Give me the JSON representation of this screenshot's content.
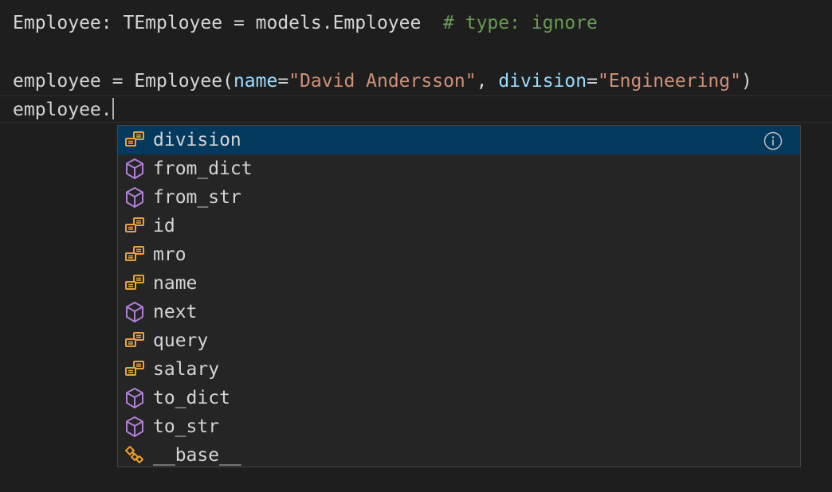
{
  "editor": {
    "line1": {
      "code": "Employee: TEmployee = models.Employee  ",
      "comment": "# type: ignore"
    },
    "line3": {
      "var": "employee = Employee(",
      "param1": "name",
      "eq1": "=",
      "str1": "\"David Andersson\"",
      "sep": ", ",
      "param2": "division",
      "eq2": "=",
      "str2": "\"Engineering\"",
      "close": ")"
    },
    "line4": {
      "text": "employee."
    }
  },
  "suggest": {
    "items": [
      {
        "label": "division",
        "kind": "field"
      },
      {
        "label": "from_dict",
        "kind": "method"
      },
      {
        "label": "from_str",
        "kind": "method"
      },
      {
        "label": "id",
        "kind": "field"
      },
      {
        "label": "mro",
        "kind": "field"
      },
      {
        "label": "name",
        "kind": "field"
      },
      {
        "label": "next",
        "kind": "method"
      },
      {
        "label": "query",
        "kind": "field"
      },
      {
        "label": "salary",
        "kind": "field"
      },
      {
        "label": "to_dict",
        "kind": "method"
      },
      {
        "label": "to_str",
        "kind": "method"
      },
      {
        "label": "__base__",
        "kind": "class"
      }
    ],
    "selected_index": 0
  },
  "colors": {
    "field_icon": "#e8a33d",
    "method_icon": "#b180d7",
    "class_icon": "#ee9d28",
    "selection": "#04395e"
  },
  "icons": {
    "field": "field-icon",
    "method": "method-cube-icon",
    "class": "class-icon",
    "info": "info-icon"
  }
}
